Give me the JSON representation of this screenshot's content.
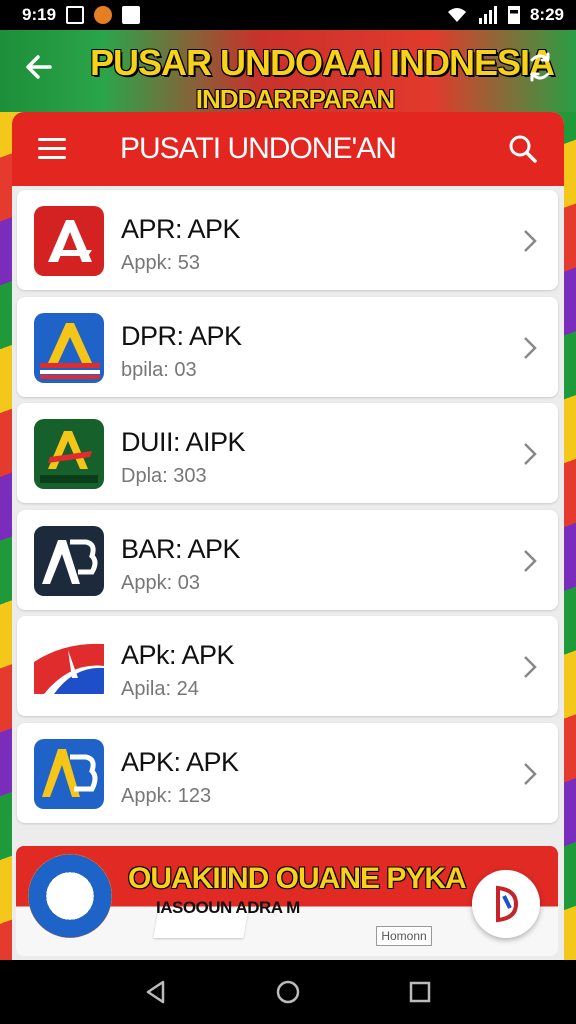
{
  "status_bar": {
    "time_left": "9:19",
    "time_right": "8:29"
  },
  "header": {
    "title": "PUSAR UNDOAAI INDNESIA",
    "subtitle": "INDDARRPARAN"
  },
  "toolbar": {
    "title": "PUSATI UNDONE'AN"
  },
  "apps": [
    {
      "title": "APR: APK",
      "subtitle": "Appk: 53",
      "icon": "app-a-red-icon"
    },
    {
      "title": "DPR: APK",
      "subtitle": "bpila: 03",
      "icon": "app-a-blue-icon"
    },
    {
      "title": "DUII: AIPK",
      "subtitle": "Dpla: 303",
      "icon": "app-a-green-icon"
    },
    {
      "title": "BAR: APK",
      "subtitle": "Appk: 03",
      "icon": "app-ab-navy-icon"
    },
    {
      "title": "APk: APK",
      "subtitle": "Apila: 24",
      "icon": "app-flag-icon"
    },
    {
      "title": "APK: APK",
      "subtitle": "Appk: 123",
      "icon": "app-ab-blue-icon"
    }
  ],
  "banner": {
    "headline": "OUAKIIND OUANE PYKA",
    "tagline": "IASOOUN ADRA M",
    "tag": "Homonn"
  },
  "colors": {
    "toolbar_red": "#e3261f",
    "title_yellow": "#f7d21b",
    "header_green": "#1e8e3a"
  }
}
